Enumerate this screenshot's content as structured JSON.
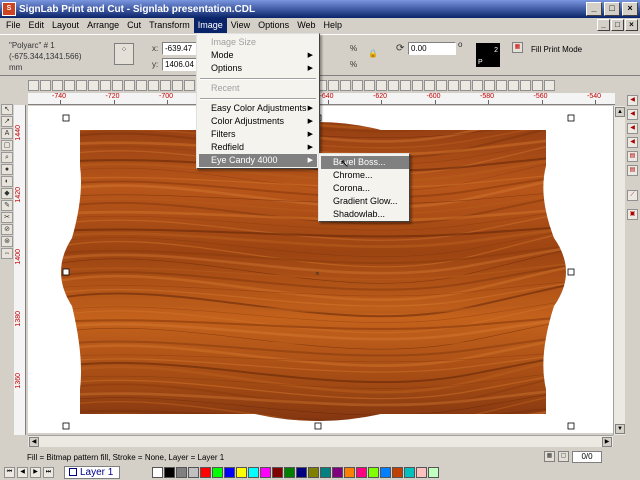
{
  "window": {
    "title": "SignLab Print and Cut - Signlab presentation.CDL"
  },
  "colors": {
    "title_bar": "#0a246a",
    "wood_light": "#c4621c",
    "wood_dark": "#6e2a08",
    "ruler_label": "#c00000",
    "menu_highlight": "#0a246a",
    "menu_selected": "#808080"
  },
  "menubar": {
    "items": [
      "File",
      "Edit",
      "Layout",
      "Arrange",
      "Cut",
      "Transform",
      "Image",
      "View",
      "Options",
      "Web",
      "Help"
    ],
    "active": "Image"
  },
  "propbar": {
    "object_name": "\"Polyarc\" # 1",
    "coords": "(-675.344,1341.566)",
    "unit": "mm",
    "x_label": "x:",
    "x_value": "-639.47",
    "y_label": "y:",
    "y_value": "1406.04",
    "rotation_value": "0.00",
    "rotation_unit": "o",
    "percent": "%",
    "swatch_p": "P",
    "swatch_num": "2",
    "print_mode_label": "Fill Print Mode"
  },
  "image_menu": {
    "items": [
      {
        "label": "Image Size",
        "disabled": true,
        "submenu": false
      },
      {
        "label": "Mode",
        "disabled": false,
        "submenu": true
      },
      {
        "label": "Options",
        "disabled": false,
        "submenu": true
      },
      {
        "label": "Recent",
        "disabled": true,
        "submenu": false
      },
      {
        "label": "Easy Color Adjustments",
        "disabled": false,
        "submenu": true
      },
      {
        "label": "Color Adjustments",
        "disabled": false,
        "submenu": true
      },
      {
        "label": "Filters",
        "disabled": false,
        "submenu": true
      },
      {
        "label": "Redfield",
        "disabled": false,
        "submenu": true
      },
      {
        "label": "Eye Candy 4000",
        "disabled": false,
        "submenu": true,
        "selected": true
      }
    ]
  },
  "eyecandy_menu": {
    "items": [
      "Bevel Boss...",
      "Chrome...",
      "Corona...",
      "Gradient Glow...",
      "Shadowlab..."
    ],
    "selected": "Bevel Boss..."
  },
  "rulers": {
    "horizontal": [
      "-740",
      "-720",
      "-700",
      "-680",
      "-660",
      "-640",
      "-620",
      "-600",
      "-580",
      "-560",
      "-540"
    ],
    "vertical": [
      "1440",
      "1420",
      "1400",
      "1380",
      "1360"
    ]
  },
  "statusbar": {
    "text": "Fill = Bitmap pattern fill, Stroke = None, Layer = Layer 1",
    "count": "0/0"
  },
  "layerbar": {
    "layer_name": "Layer 1"
  },
  "palette": [
    "#ffffff",
    "#000000",
    "#808080",
    "#c0c0c0",
    "#ff0000",
    "#00ff00",
    "#0000ff",
    "#ffff00",
    "#00ffff",
    "#ff00ff",
    "#800000",
    "#008000",
    "#000080",
    "#808000",
    "#008080",
    "#800080",
    "#ff8000",
    "#ff0080",
    "#80ff00",
    "#0080ff",
    "#c04000",
    "#00c0c0",
    "#ffc0c0",
    "#c0ffc0"
  ]
}
